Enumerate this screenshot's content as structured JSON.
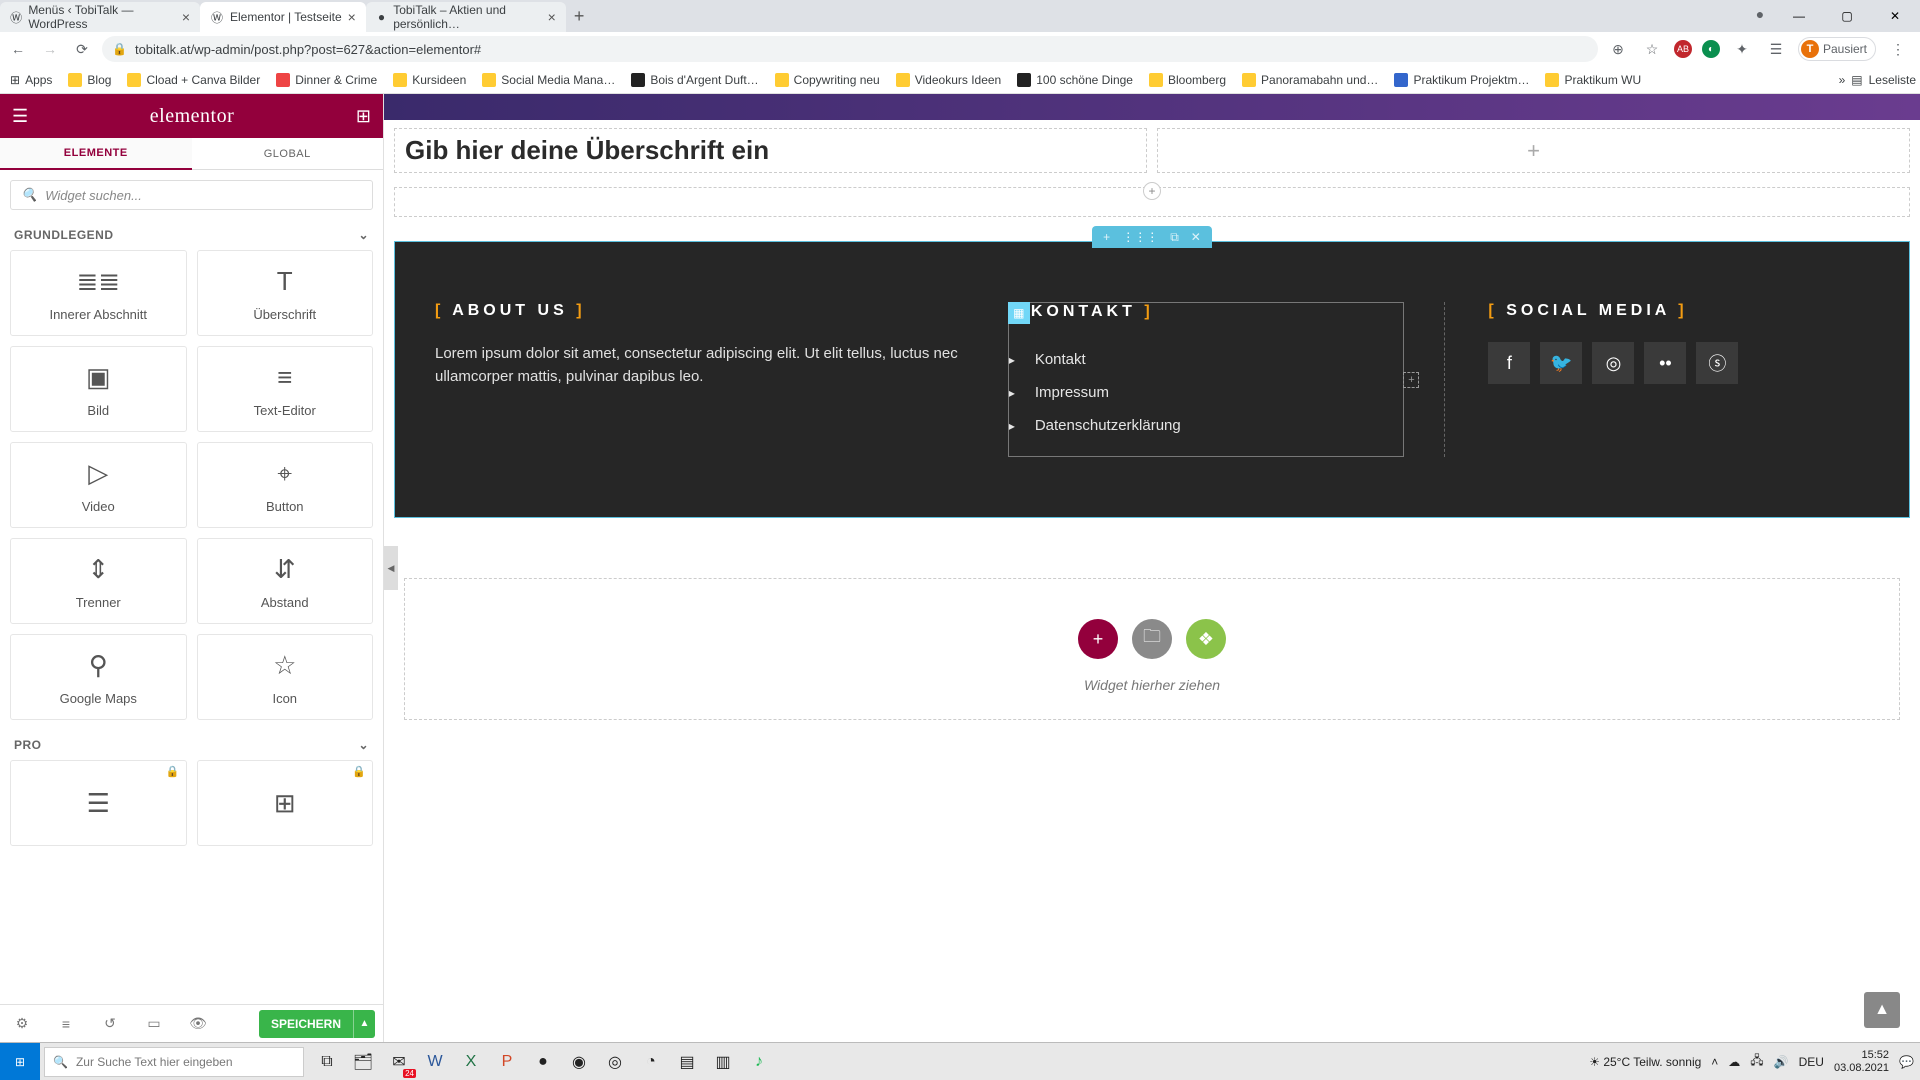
{
  "browser": {
    "tabs": [
      {
        "title": "Menüs ‹ TobiTalk — WordPress",
        "favicon": "W"
      },
      {
        "title": "Elementor | Testseite",
        "favicon": "W",
        "active": true
      },
      {
        "title": "TobiTalk – Aktien und persönlich…",
        "favicon": "●"
      }
    ],
    "url": "tobitalk.at/wp-admin/post.php?post=627&action=elementor#",
    "profile_label": "Pausiert",
    "profile_initial": "T",
    "bookmarks": [
      "Apps",
      "Blog",
      "Cload + Canva Bilder",
      "Dinner & Crime",
      "Kursideen",
      "Social Media Mana…",
      "Bois d'Argent Duft…",
      "Copywriting neu",
      "Videokurs Ideen",
      "100 schöne Dinge",
      "Bloomberg",
      "Panoramabahn und…",
      "Praktikum Projektm…",
      "Praktikum WU"
    ],
    "overflow": "»",
    "reading_list": "Leseliste"
  },
  "sidebar": {
    "logo": "elementor",
    "tabs": {
      "elements": "ELEMENTE",
      "global": "GLOBAL"
    },
    "search_placeholder": "Widget suchen...",
    "cat_basic": "GRUNDLEGEND",
    "cat_pro": "PRO",
    "widgets_basic": [
      {
        "label": "Innerer Abschnitt",
        "icon": "≣≣"
      },
      {
        "label": "Überschrift",
        "icon": "T"
      },
      {
        "label": "Bild",
        "icon": "▣"
      },
      {
        "label": "Text-Editor",
        "icon": "≡"
      },
      {
        "label": "Video",
        "icon": "▷"
      },
      {
        "label": "Button",
        "icon": "⌖"
      },
      {
        "label": "Trenner",
        "icon": "⇕"
      },
      {
        "label": "Abstand",
        "icon": "⇵"
      },
      {
        "label": "Google Maps",
        "icon": "⚲"
      },
      {
        "label": "Icon",
        "icon": "☆"
      }
    ],
    "widgets_pro": [
      {
        "label": "",
        "icon": "☰"
      },
      {
        "label": "",
        "icon": "⊞"
      }
    ],
    "save": "SPEICHERN"
  },
  "canvas": {
    "heading_placeholder": "Gib hier deine Überschrift ein",
    "footer": {
      "about": {
        "title": "ABOUT US",
        "text": "Lorem ipsum dolor sit amet, consectetur adipiscing elit. Ut elit tellus, luctus nec ullamcorper mattis, pulvinar dapibus leo."
      },
      "kontakt": {
        "title": "KONTAKT",
        "links": [
          "Kontakt",
          "Impressum",
          "Datenschutzerklärung"
        ]
      },
      "social": {
        "title": "SOCIAL MEDIA",
        "icons": [
          "facebook",
          "twitter",
          "instagram",
          "flickr",
          "500px"
        ]
      }
    },
    "drop_hint": "Widget hierher ziehen"
  },
  "taskbar": {
    "search_placeholder": "Zur Suche Text hier eingeben",
    "weather": "25°C  Teilw. sonnig",
    "lang": "DEU",
    "time": "15:52",
    "date": "03.08.2021",
    "mail_badge": "24"
  }
}
